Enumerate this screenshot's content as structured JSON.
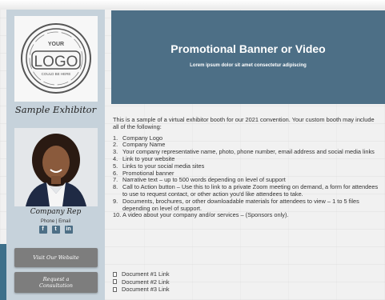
{
  "sidebar": {
    "logo": {
      "line1": "YOUR",
      "line2": "LOGO",
      "line3": "COULD BE HERE"
    },
    "exhibitor_name": "Sample Exhibitor",
    "rep_name": "Company Rep",
    "rep_links": "Phone | Email",
    "social": [
      {
        "icon": "facebook-icon",
        "glyph": "f"
      },
      {
        "icon": "twitter-icon",
        "glyph": "t"
      },
      {
        "icon": "linkedin-icon",
        "glyph": "in"
      }
    ],
    "website_button": "Visit Our Website",
    "consult_button_line1": "Request a",
    "consult_button_line2": "Consultation"
  },
  "banner": {
    "title": "Promotional Banner or Video",
    "subtitle": "Lorem ipsum dolor sit amet consectetur adipiscing"
  },
  "content": {
    "intro": "This is a sample of a virtual exhibitor booth for our 2021 convention. Your custom booth may include all of the following:",
    "items": [
      "Company Logo",
      "Company Name",
      "Your company representative name, photo, phone number, email address and social media links",
      "Link to your website",
      "Links to your social media sites",
      "Promotional banner",
      "Narrative text – up to 500 words depending on level of support",
      "Call to Action button – Use this to link to a private Zoom meeting on demand, a form for attendees to use to request contact, or other action you'd like attendees to take.",
      "Documents, brochures, or other downloadable materials for attendees to view – 1 to 5 files depending on level of support.",
      "A video about your company and/or services – (Sponsors only)."
    ]
  },
  "documents": [
    "Document #1 Link",
    "Document #2 Link",
    "Document #3 Link"
  ],
  "colors": {
    "banner": "#4d6f86",
    "sidebar": "#c6d2db",
    "button": "#7d7d7d"
  }
}
